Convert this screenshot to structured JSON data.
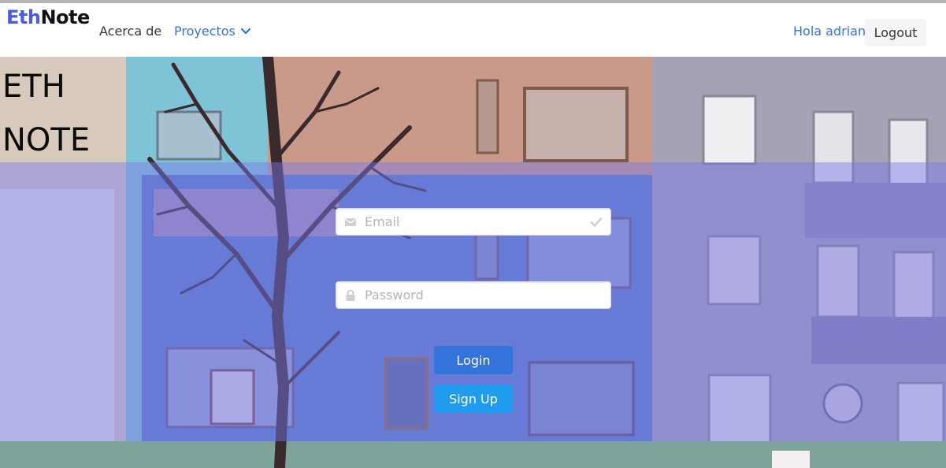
{
  "navbar": {
    "brand_part1": "Eth",
    "brand_part2": "Note",
    "about_label": "Acerca de",
    "projects_label": "Proyectos",
    "greeting": "Hola adriana",
    "logout_label": "Logout"
  },
  "hero": {
    "title_line1": "ETH",
    "title_line2": "NOTE"
  },
  "login_form": {
    "email_placeholder": "Email",
    "email_value": "",
    "password_placeholder": "Password",
    "password_value": "",
    "login_label": "Login",
    "signup_label": "Sign Up"
  },
  "icons": {
    "email": "envelope-icon",
    "email_status": "check-icon",
    "password": "lock-icon",
    "projects_dropdown": "chevron-down-icon"
  },
  "colors": {
    "link": "#3273dc",
    "brand_accent": "#4a5de0",
    "login_button": "#3273dc",
    "signup_button": "#209cee",
    "overlay_tint": "#7878eb"
  }
}
